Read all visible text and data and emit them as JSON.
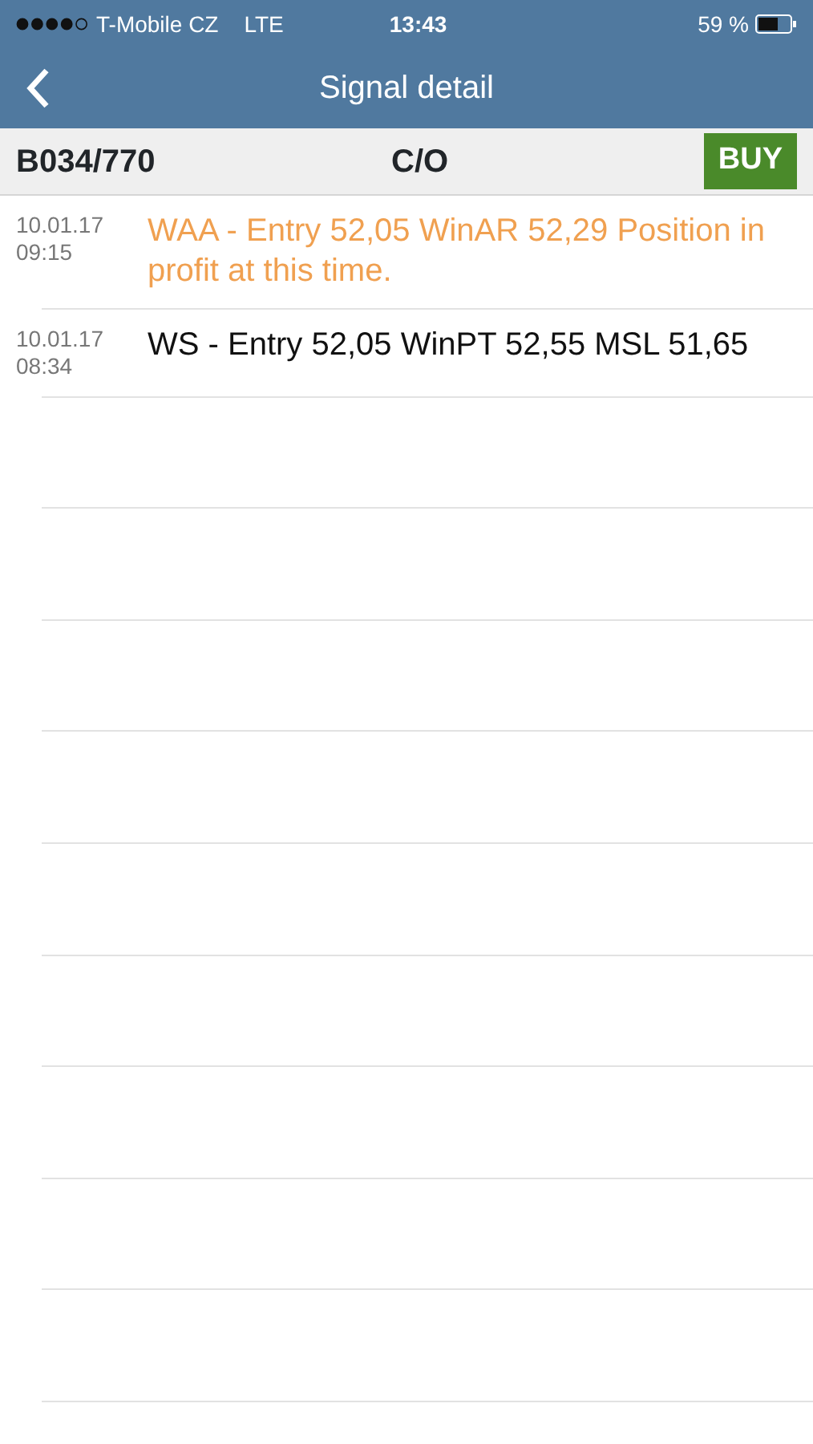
{
  "status_bar": {
    "carrier": "T-Mobile CZ",
    "network": "LTE",
    "time": "13:43",
    "battery": "59 %"
  },
  "nav": {
    "title": "Signal detail"
  },
  "header": {
    "symbol": "B034/770",
    "type": "C/O",
    "action": "BUY"
  },
  "messages": [
    {
      "date": "10.01.17",
      "time": "09:15",
      "text": "WAA - Entry 52,05 WinAR 52,29 Position in profit at this time.",
      "color": "#f0a050"
    },
    {
      "date": "10.01.17",
      "time": "08:34",
      "text": "WS - Entry 52,05 WinPT 52,55 MSL 51,65",
      "color": "#111111"
    }
  ]
}
